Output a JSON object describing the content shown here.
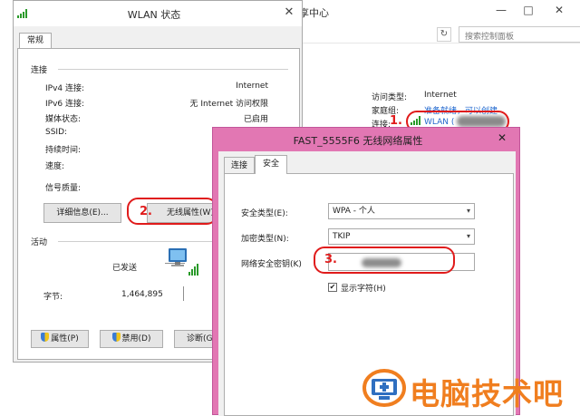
{
  "background_window": {
    "title": "享中心",
    "search_placeholder": "搜索控制面板",
    "refresh": "↻",
    "minimize": "—",
    "maximize": "□",
    "close": "✕",
    "info": {
      "access_type_label": "访问类型:",
      "access_type_value": "Internet",
      "homegroup_label": "家庭组:",
      "homegroup_value": "准备就绪，可以创建",
      "connection_label": "连接:",
      "connection_value": "WLAN ("
    }
  },
  "wlan_status": {
    "title": "WLAN 状态",
    "close": "✕",
    "tab": "常规",
    "connection_section": "连接",
    "rows": [
      {
        "label": "IPv4 连接:",
        "value": "Internet"
      },
      {
        "label": "IPv6 连接:",
        "value": "无 Internet 访问权限"
      },
      {
        "label": "媒体状态:",
        "value": "已启用"
      },
      {
        "label": "SSID:",
        "value": ""
      },
      {
        "label": "持续时间:",
        "value": ""
      },
      {
        "label": "速度:",
        "value": ""
      }
    ],
    "signal_label": "信号质量:",
    "details_button": "详细信息(E)...",
    "wireless_props_button": "无线属性(W)",
    "activity_section": "活动",
    "sent_label": "已发送",
    "bytes_label": "字节:",
    "bytes_sent": "1,464,895",
    "properties_button": "属性(P)",
    "disable_button": "禁用(D)",
    "diagnose_button": "诊断(G)"
  },
  "wireless_properties": {
    "title": "FAST_5555F6 无线网络属性",
    "close": "✕",
    "tabs": [
      {
        "label": "连接",
        "active": false
      },
      {
        "label": "安全",
        "active": true
      }
    ],
    "security_type_label": "安全类型(E):",
    "security_type_value": "WPA - 个人",
    "encryption_type_label": "加密类型(N):",
    "encryption_type_value": "TKIP",
    "network_key_label": "网络安全密钥(K)",
    "show_chars_label": "显示字符(H)",
    "show_chars_checked": true
  },
  "annotations": {
    "step1": "1.",
    "step2": "2.",
    "step3": "3."
  },
  "watermark": {
    "text": "电脑技术吧"
  },
  "colors": {
    "annotation_red": "#e01b1b",
    "dialog_accent_pink": "#e277b3",
    "link_blue": "#2266cc",
    "watermark_orange": "#f07e1f"
  }
}
